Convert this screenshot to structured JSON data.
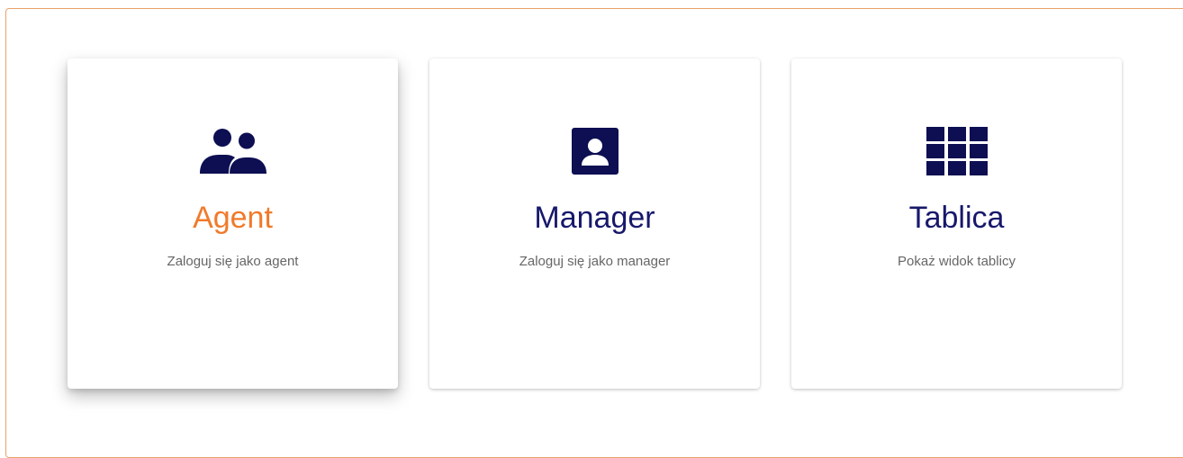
{
  "colors": {
    "icon": "#0d0f52",
    "title": "#17186b",
    "title_active": "#f07a2a",
    "subtitle": "#666666",
    "frame_border": "#e8a26a"
  },
  "cards": [
    {
      "title": "Agent",
      "subtitle": "Zaloguj się jako agent",
      "icon": "people-icon",
      "active": true
    },
    {
      "title": "Manager",
      "subtitle": "Zaloguj się jako manager",
      "icon": "account-box-icon",
      "active": false
    },
    {
      "title": "Tablica",
      "subtitle": "Pokaż widok tablicy",
      "icon": "grid-icon",
      "active": false
    }
  ]
}
